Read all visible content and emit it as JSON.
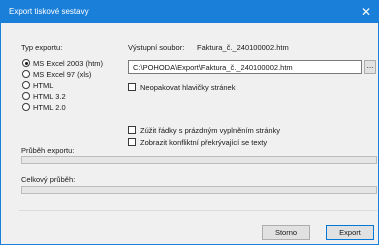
{
  "window": {
    "title": "Export tiskové sestavy",
    "close_glyph": "✕"
  },
  "export_type": {
    "label": "Typ exportu:",
    "options": [
      {
        "label": "MS Excel 2003 (htm)",
        "checked": true
      },
      {
        "label": "MS Excel  97 (xls)",
        "checked": false
      },
      {
        "label": "HTML",
        "checked": false
      },
      {
        "label": "HTML 3.2",
        "checked": false
      },
      {
        "label": "HTML 2.0",
        "checked": false
      }
    ]
  },
  "output_file": {
    "label": "Výstupní soubor:",
    "filename": "Faktura_č._240100002.htm",
    "path": "C:\\POHODA\\Export\\Faktura_č._240100002.htm",
    "browse_label": "..."
  },
  "options": {
    "no_repeat_headers": {
      "label": "Neopakovat hlavičky stránek",
      "checked": false
    },
    "shrink_rows": {
      "label": "Zúžit řádky s prázdným vyplněním stránky",
      "checked": false
    },
    "show_conflicts": {
      "label": "Zobrazit konfliktní překrývající se texty",
      "checked": false
    }
  },
  "progress": {
    "export_label": "Průběh exportu:",
    "export_value": 0,
    "total_label": "Celkový průběh:",
    "total_value": 0
  },
  "buttons": {
    "cancel": "Storno",
    "export": "Export"
  },
  "icons": {
    "close": "close-icon"
  },
  "colors": {
    "titlebar": "#1a7fd8",
    "progress_fill": "#06b025"
  }
}
